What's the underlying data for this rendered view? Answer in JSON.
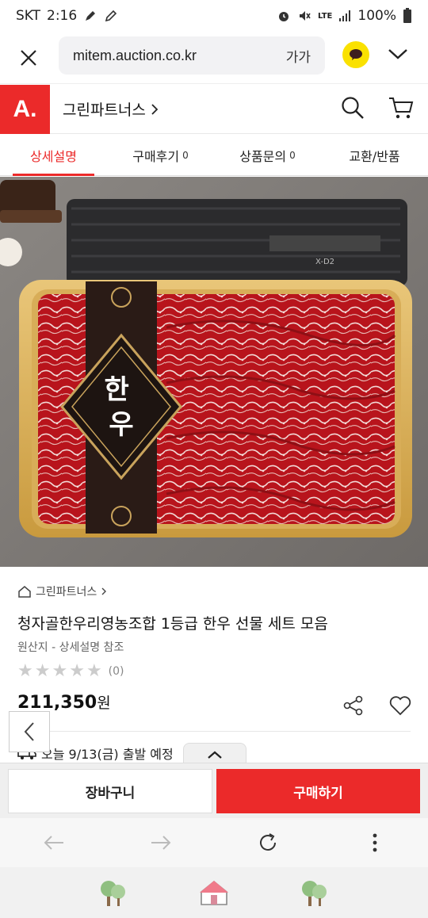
{
  "status_bar": {
    "carrier": "SKT",
    "time": "2:16",
    "network": "LTE",
    "battery": "100%"
  },
  "browser": {
    "url": "mitem.auction.co.kr",
    "text_size_label": "가가"
  },
  "site": {
    "logo": "A.",
    "seller_name": "그린파트너스",
    "accent_color": "#eb2a2a"
  },
  "tabs": [
    {
      "label": "상세설명",
      "count": ""
    },
    {
      "label": "구매후기",
      "count": "0"
    },
    {
      "label": "상품문의",
      "count": "0"
    },
    {
      "label": "교환/반품",
      "count": ""
    }
  ],
  "product": {
    "image_label": "한우",
    "package_code": "X-D2",
    "breadcrumb": "그린파트너스",
    "title": "청자골한우리영농조합 1등급 한우 선물 세트 모음",
    "origin": "원산지 - 상세설명 참조",
    "rating_count": "(0)",
    "rating_stars": 0,
    "price": "211,350",
    "price_unit": "원",
    "delivery": "오늘 9/13(금) 출발 예정"
  },
  "actions": {
    "cart_label": "장바구니",
    "buy_label": "구매하기"
  }
}
